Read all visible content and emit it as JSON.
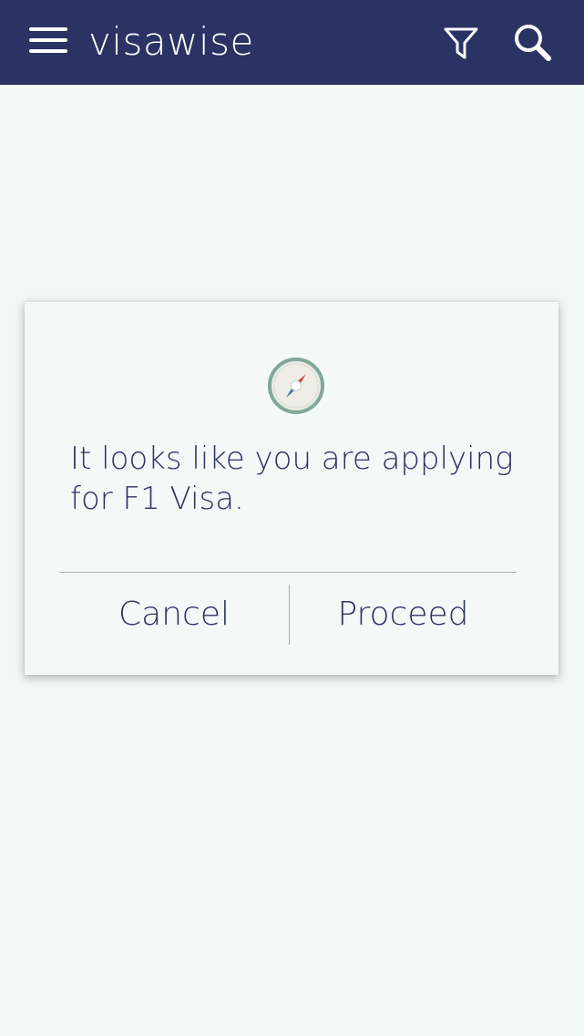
{
  "app_bar": {
    "title": "visawise",
    "background_color": "#2b3264",
    "menu_icon": "hamburger-menu-icon",
    "filter_icon": "filter-funnel-icon",
    "search_icon": "search-magnifier-icon"
  },
  "dialog": {
    "icon": "compass-icon",
    "message": "It looks like you are applying for F1 Visa.",
    "cancel_label": "Cancel",
    "proceed_label": "Proceed"
  },
  "colors": {
    "page_background": "#f1f8f5",
    "text": "#2b3264",
    "compass_ring": "#7fa89a",
    "compass_north": "#d0463c",
    "compass_south": "#4a6fb0"
  }
}
